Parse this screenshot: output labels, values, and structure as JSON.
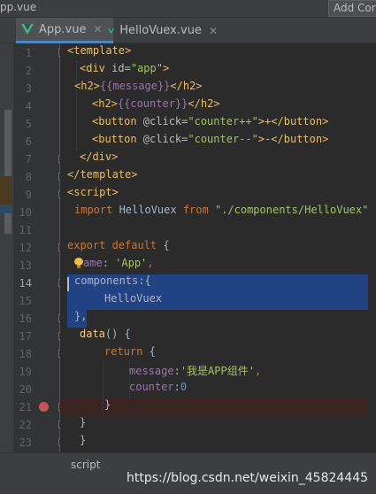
{
  "window": {
    "title_file": "pp.vue",
    "config_button": "Add Cor"
  },
  "tabs": [
    {
      "label": "App.vue",
      "active": true
    },
    {
      "label": "HelloVuex.vue",
      "active": false
    }
  ],
  "tab_close_glyph": "✕",
  "icons": {
    "tab_file": "vue-logo-icon",
    "fold": "fold-marker-icon",
    "breakpoint": "breakpoint-icon",
    "intention": "lightbulb-icon"
  },
  "colors": {
    "tag": "#e8bf6a",
    "string": "#a5c261",
    "keyword": "#cc7832",
    "property": "#9876aa",
    "number": "#6897bb",
    "selection": "#214283",
    "breakpoint": "#c75450",
    "vue_green": "#41b883"
  },
  "editor": {
    "line_numbers": [
      "1",
      "2",
      "3",
      "4",
      "5",
      "6",
      "7",
      "8",
      "9",
      "10",
      "11",
      "12",
      "13",
      "14",
      "15",
      "16",
      "17",
      "18",
      "19",
      "20",
      "21",
      "22",
      "23"
    ],
    "current_line": 14,
    "breakpoint_line": 21,
    "selected_lines": [
      14,
      15,
      16
    ]
  },
  "code": {
    "l1_tag": "<template>",
    "l2_open": "<div ",
    "l2_attr": "id=",
    "l2_val": "\"app\"",
    "l2_close": ">",
    "l3_open": "<h2>",
    "l3_tpl_open": "{{",
    "l3_var": "message",
    "l3_tpl_close": "}}",
    "l3_close": "</h2>",
    "l4_open": "<h2>",
    "l4_tpl_open": "{{",
    "l4_var": "counter",
    "l4_tpl_close": "}}",
    "l4_close": "</h2>",
    "l5_open": "<button ",
    "l5_attr": "@click=",
    "l5_val": "\"counter++\"",
    "l5_text": ">+</button>",
    "l6_open": "<button ",
    "l6_attr": "@click=",
    "l6_val": "\"counter--\"",
    "l6_text": ">-</button>",
    "l7_tag": "</div>",
    "l8_tag": "</template>",
    "l9_tag": "<script>",
    "l10_kw": "import ",
    "l10_name": "HelloVuex ",
    "l10_from": "from ",
    "l10_str": "\"./components/HelloVuex\"",
    "l10_semi": ";",
    "l12_kw": "export default ",
    "l12_brace": "{",
    "l13_prop": "ame",
    "l13_colon": ": ",
    "l13_str": "'App'",
    "l13_comma": ",",
    "l14_text": "components:{",
    "l15_text": "HelloVuex",
    "l16_text": "},",
    "l17_fn": "data",
    "l17_rest": "() {",
    "l18_kw": "return ",
    "l18_brace": "{",
    "l19_prop": "message",
    "l19_colon": ":",
    "l19_str": "'我是APP组件'",
    "l19_comma": ",",
    "l20_prop": "counter",
    "l20_colon": ":",
    "l20_num": "0",
    "l21_text": "}",
    "l22_text": "}",
    "l23_text": "}"
  },
  "breadcrumb": "script",
  "watermark": "https://blog.csdn.net/weixin_45824445"
}
